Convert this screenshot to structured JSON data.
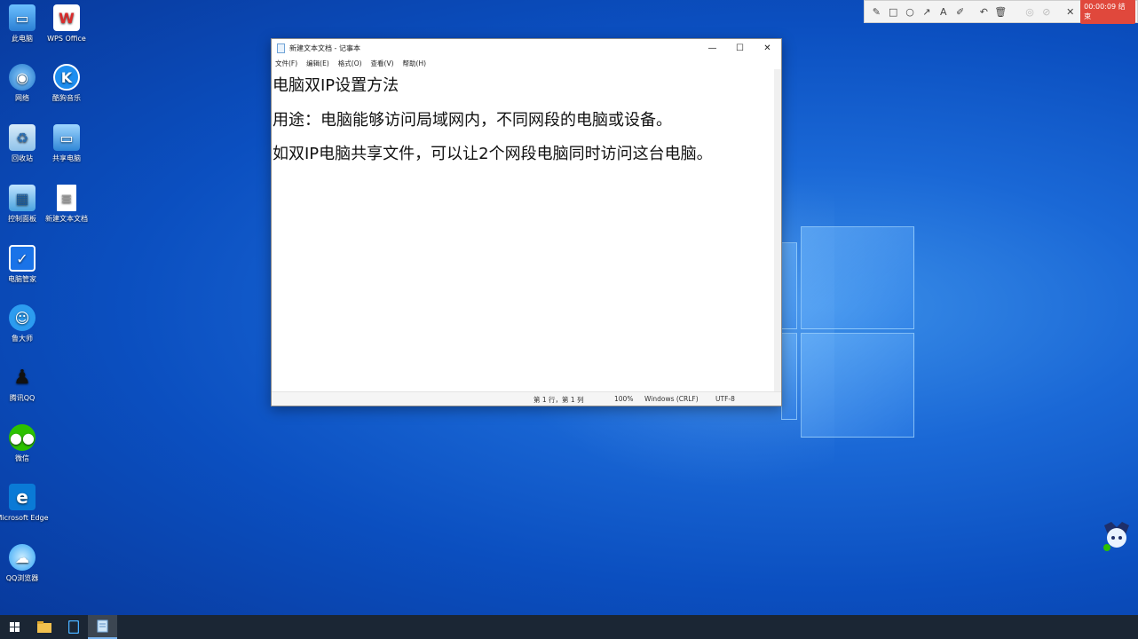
{
  "desktop": {
    "icons": [
      {
        "label": "此电脑",
        "icon": "this-pc-icon",
        "color": "#3f9be8"
      },
      {
        "label": "WPS Office",
        "icon": "wps-office-icon",
        "color": "#d92b2b"
      },
      {
        "label": "网络",
        "icon": "network-icon",
        "color": "#2f86d6"
      },
      {
        "label": "酷狗音乐",
        "icon": "kugou-music-icon",
        "color": "#1d8ef0"
      },
      {
        "label": "回收站",
        "icon": "recycle-bin-icon",
        "color": "#8fc2ea"
      },
      {
        "label": "共享电脑",
        "icon": "shared-pc-icon",
        "color": "#3f9be8"
      },
      {
        "label": "控制面板",
        "icon": "control-panel-icon",
        "color": "#4aa3df"
      },
      {
        "label": "新建文本文档",
        "icon": "text-document-icon",
        "color": "#ffffff"
      },
      {
        "label": "电脑管家",
        "icon": "pc-manager-icon",
        "color": "#1a73e8"
      },
      {
        "label": "鲁大师",
        "icon": "ludashi-icon",
        "color": "#2c9cf0"
      },
      {
        "label": "腾讯QQ",
        "icon": "qq-icon",
        "color": "#111111"
      },
      {
        "label": "微信",
        "icon": "wechat-icon",
        "color": "#2dc100"
      },
      {
        "label": "Microsoft Edge",
        "icon": "edge-icon",
        "color": "#0a7ad6"
      },
      {
        "label": "QQ浏览器",
        "icon": "qq-browser-icon",
        "color": "#2fa3f5"
      }
    ]
  },
  "annotation_toolbar": {
    "tools": [
      "pen-icon",
      "rectangle-icon",
      "circle-icon",
      "arrow-icon",
      "text-icon",
      "highlighter-icon",
      "undo-icon",
      "delete-icon",
      "eye-icon",
      "hide-icon",
      "close-icon"
    ],
    "record_button": "00:00:09 结束",
    "record_color": "#e0483c"
  },
  "notepad": {
    "title": "新建文本文档 - 记事本",
    "menu": [
      "文件(F)",
      "编辑(E)",
      "格式(O)",
      "查看(V)",
      "帮助(H)"
    ],
    "lines": [
      "电脑双IP设置方法",
      "用途：电脑能够访问局域网内，不同网段的电脑或设备。",
      "如双IP电脑共享文件，可以让2个网段电脑同时访问这台电脑。"
    ],
    "status": {
      "position": "第 1 行，第 1 列",
      "zoom": "100%",
      "line_ending": "Windows (CRLF)",
      "encoding": "UTF-8"
    }
  },
  "taskbar": {
    "items": [
      "start-icon",
      "file-explorer-icon",
      "tablet-app-icon",
      "notepad-icon"
    ],
    "active": "notepad-icon"
  }
}
